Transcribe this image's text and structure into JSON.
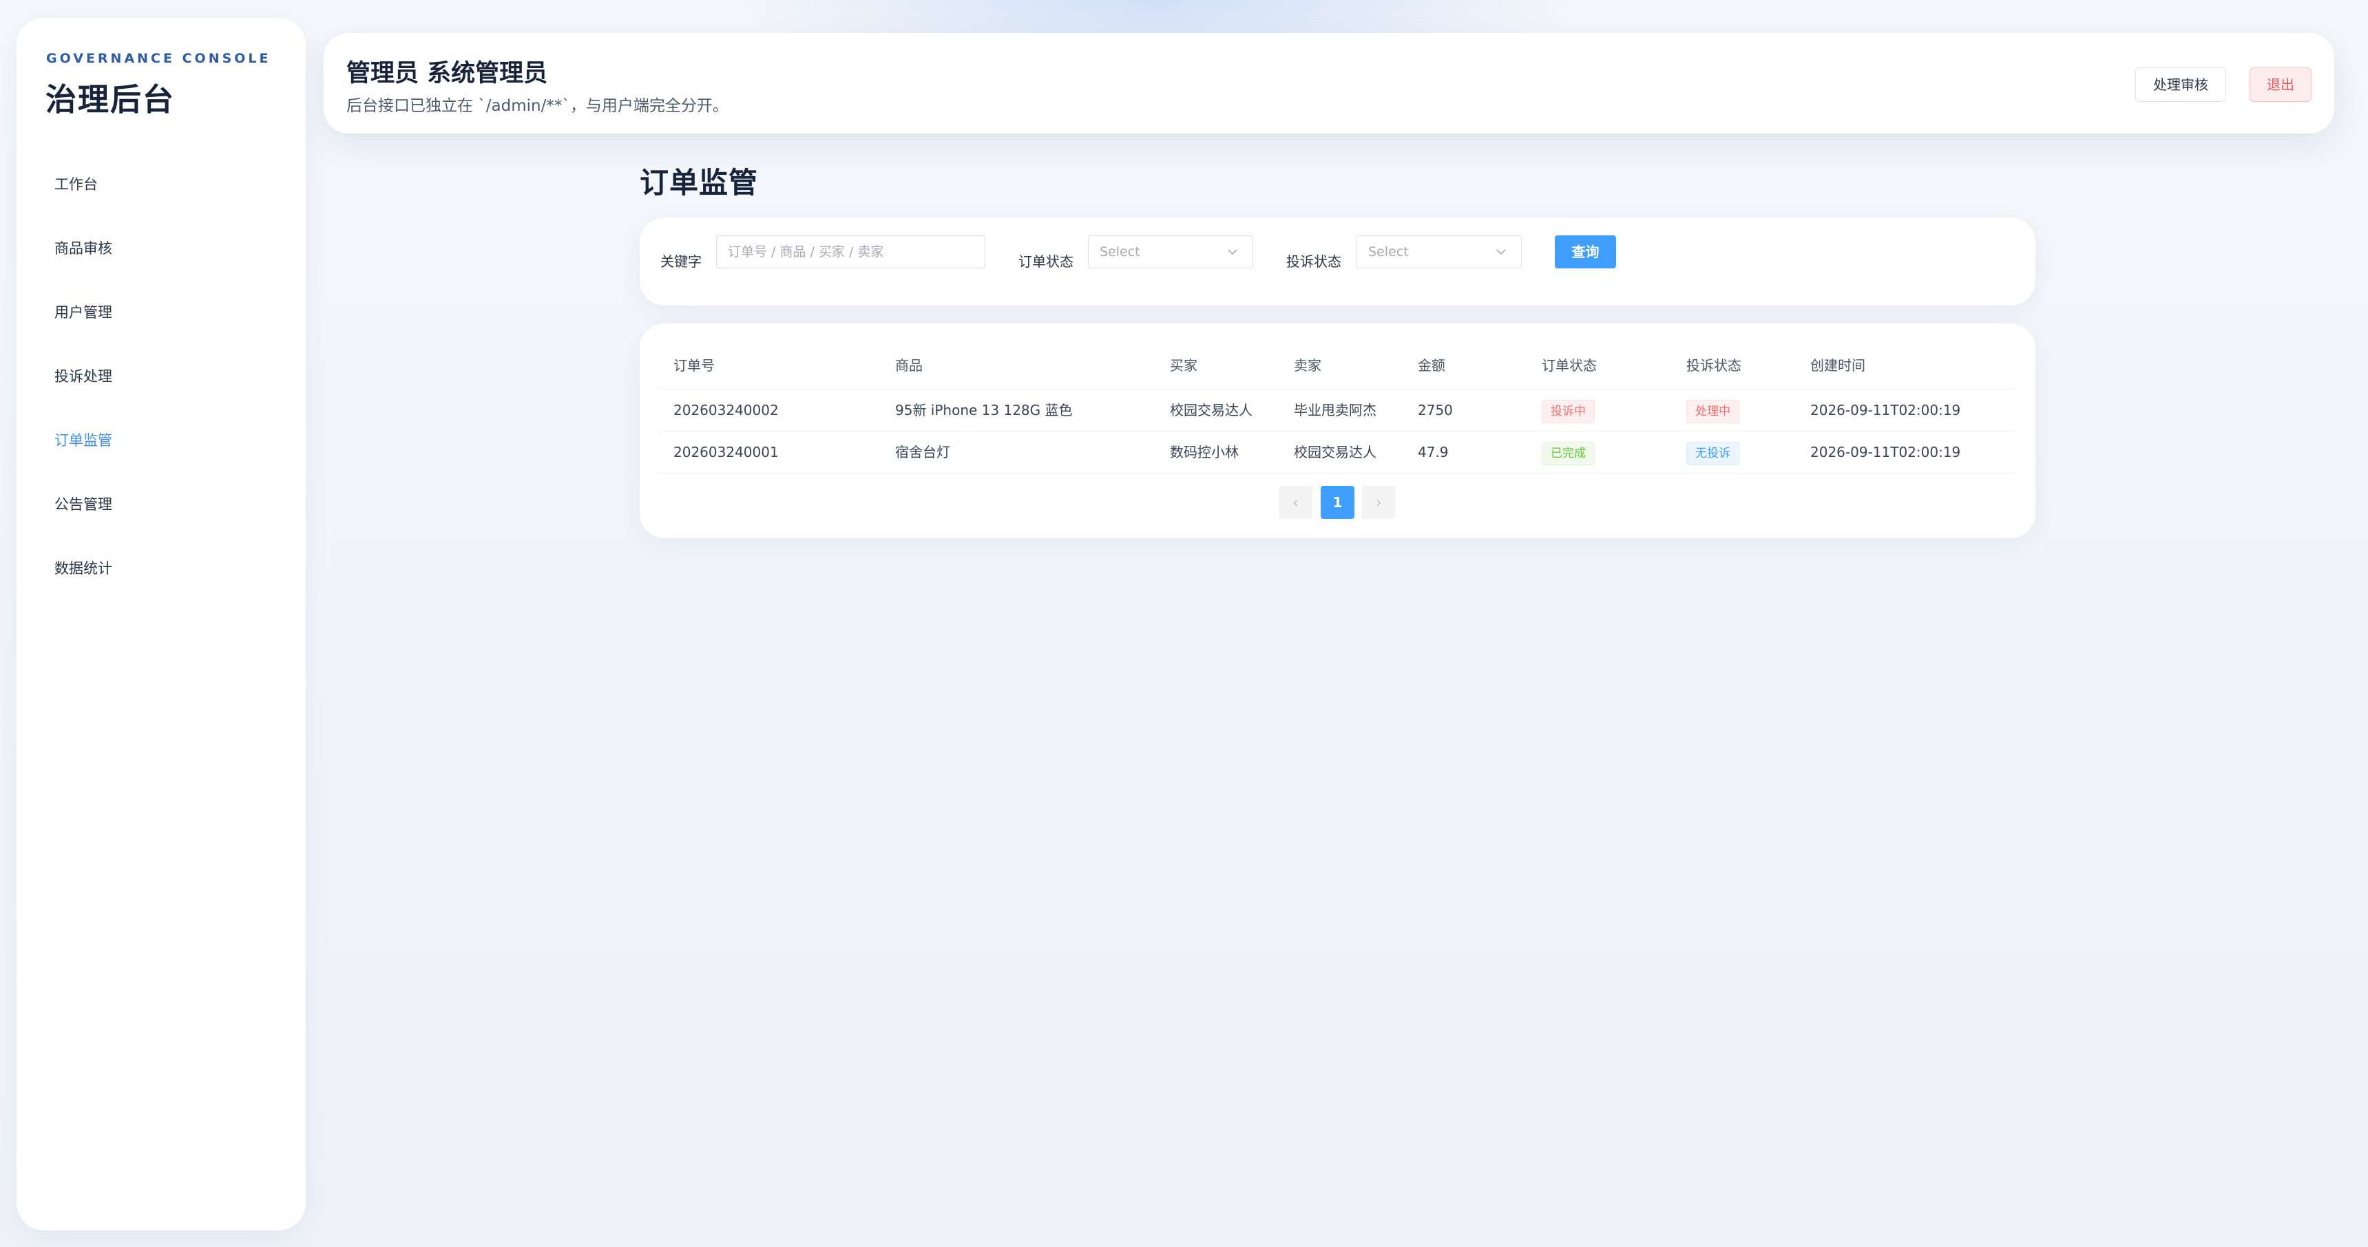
{
  "sidebar": {
    "eyebrow": "GOVERNANCE CONSOLE",
    "title": "治理后台",
    "items": [
      {
        "label": "工作台"
      },
      {
        "label": "商品审核"
      },
      {
        "label": "用户管理"
      },
      {
        "label": "投诉处理"
      },
      {
        "label": "订单监管"
      },
      {
        "label": "公告管理"
      },
      {
        "label": "数据统计"
      }
    ],
    "active_index": 4
  },
  "header": {
    "title": "管理员 系统管理员",
    "subtitle": "后台接口已独立在 `/admin/**`，与用户端完全分开。",
    "review_button": "处理审核",
    "logout_button": "退出"
  },
  "page": {
    "title": "订单监管"
  },
  "filters": {
    "keyword_label": "关键字",
    "keyword_placeholder": "订单号 / 商品 / 买家 / 卖家",
    "order_status_label": "订单状态",
    "order_status_placeholder": "Select",
    "complaint_status_label": "投诉状态",
    "complaint_status_placeholder": "Select",
    "query_button": "查询"
  },
  "table": {
    "columns": [
      "订单号",
      "商品",
      "买家",
      "卖家",
      "金额",
      "订单状态",
      "投诉状态",
      "创建时间"
    ],
    "rows": [
      {
        "order_no": "202603240002",
        "product": "95新 iPhone 13 128G 蓝色",
        "buyer": "校园交易达人",
        "seller": "毕业甩卖阿杰",
        "amount": "2750",
        "order_status": "投诉中",
        "complaint_status": "处理中",
        "created_at": "2026-09-11T02:00:19"
      },
      {
        "order_no": "202603240001",
        "product": "宿舍台灯",
        "buyer": "数码控小林",
        "seller": "校园交易达人",
        "amount": "47.9",
        "order_status": "已完成",
        "complaint_status": "无投诉",
        "created_at": "2026-09-11T02:00:19"
      }
    ]
  },
  "pagination": {
    "current": "1",
    "prev_icon": "‹",
    "next_icon": "›"
  },
  "colors": {
    "accent": "#409eff",
    "brand": "#2f5ba8",
    "danger": "#f56c6c",
    "success": "#67c23a"
  }
}
